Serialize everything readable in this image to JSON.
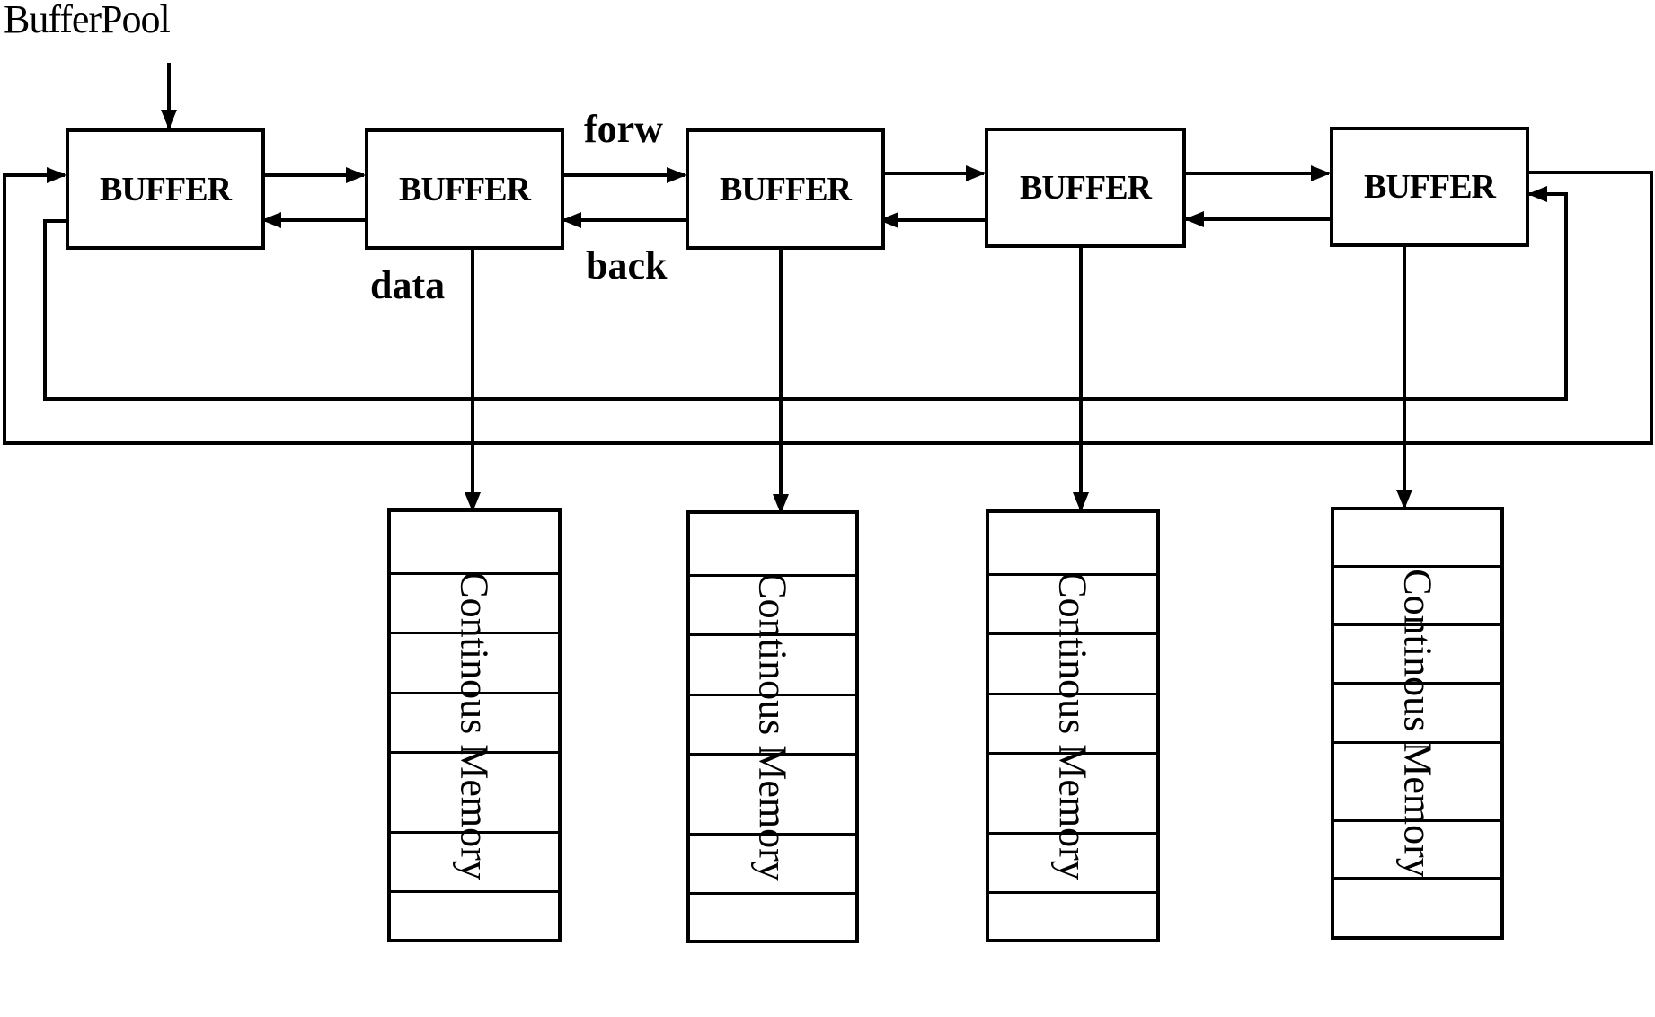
{
  "title": "BufferPool",
  "labels": {
    "forw": "forw",
    "back": "back",
    "data": "data"
  },
  "buffers": [
    {
      "label": "BUFFER"
    },
    {
      "label": "BUFFER"
    },
    {
      "label": "BUFFER"
    },
    {
      "label": "BUFFER"
    },
    {
      "label": "BUFFER"
    }
  ],
  "memories": [
    {
      "label": "Continous Memory",
      "cells": 7
    },
    {
      "label": "Continous Memory",
      "cells": 7
    },
    {
      "label": "Continous Memory",
      "cells": 7
    },
    {
      "label": "Continous Memory",
      "cells": 7
    }
  ],
  "colors": {
    "line": "#000000",
    "background": "#ffffff"
  }
}
